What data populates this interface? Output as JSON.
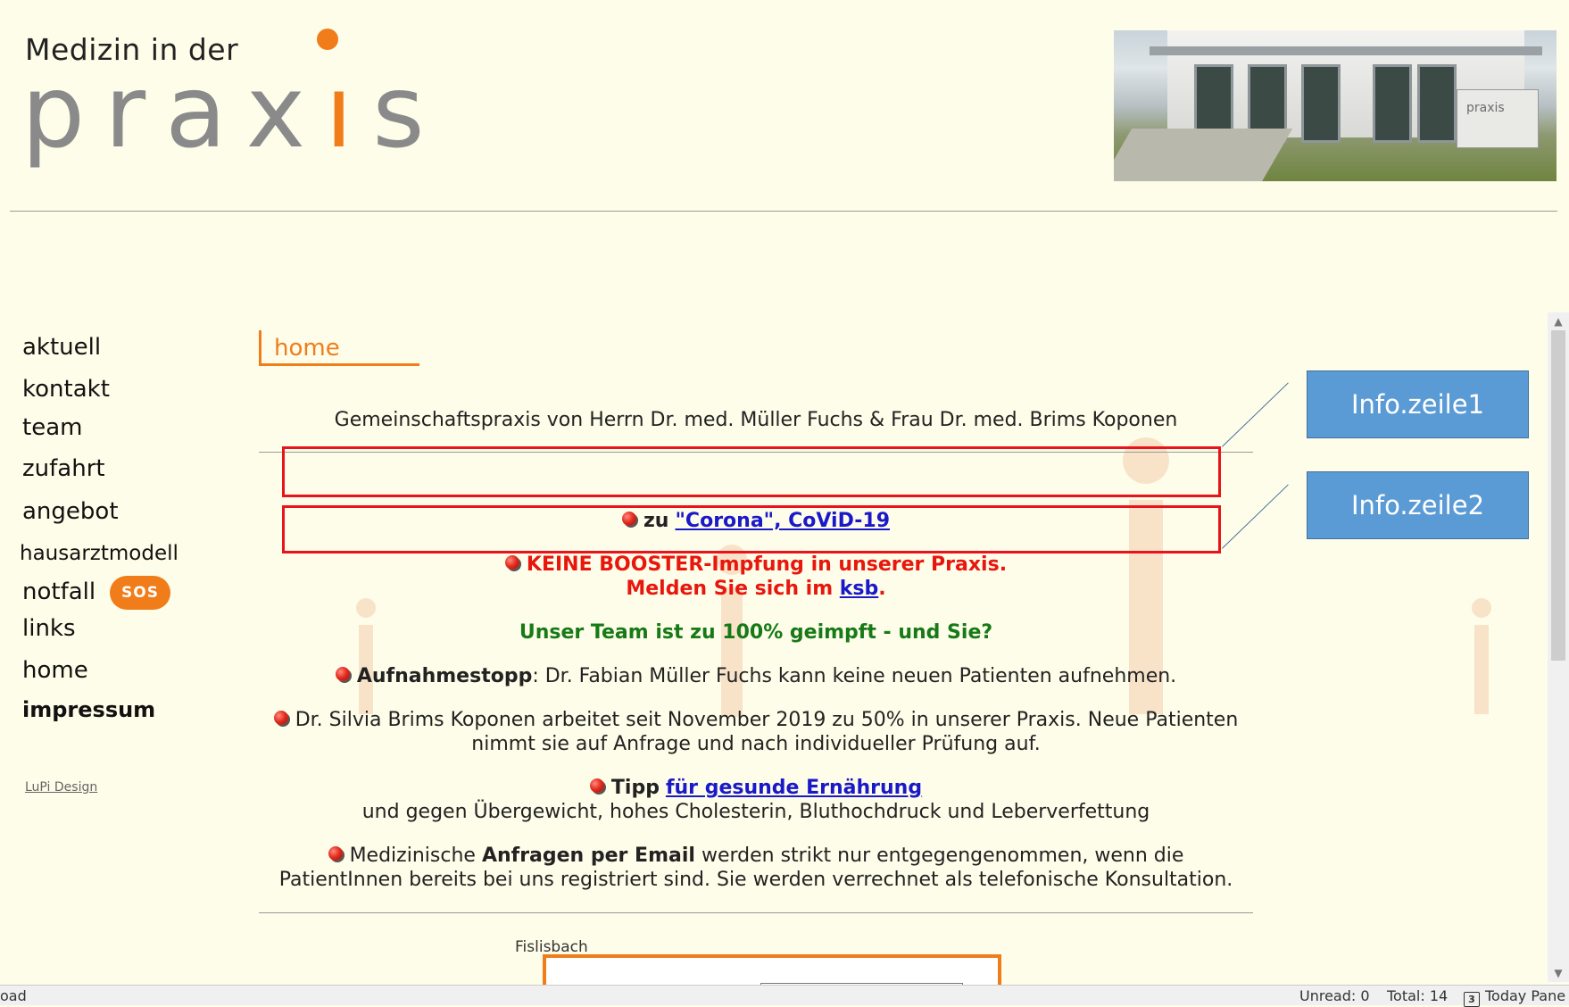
{
  "logo": {
    "small": "Medizin in der",
    "big_prefix": "prax",
    "big_i": "ı",
    "big_suffix": "s"
  },
  "building_sign": "praxis",
  "nav": [
    {
      "label": "aktuell"
    },
    {
      "label": "kontakt"
    },
    {
      "label": "team"
    },
    {
      "label": "zufahrt"
    },
    {
      "label": "angebot"
    },
    {
      "label": "hausarztmodell"
    },
    {
      "label": "notfall"
    },
    {
      "label": "links"
    },
    {
      "label": "home"
    },
    {
      "label": "impressum"
    }
  ],
  "sos_badge": "SOS",
  "credit": "LuPi Design",
  "page_title": "home",
  "content": {
    "intro": "Gemeinschaftspraxis von Herrn Dr. med. Müller Fuchs & Frau Dr. med. Brims Koponen",
    "corona_prefix": "zu",
    "corona_link": "\"Corona\", CoViD-19",
    "booster_line1": "KEINE BOOSTER-Impfung in unserer Praxis.",
    "booster_line2_prefix": "Melden Sie sich im",
    "booster_link": "ksb",
    "booster_line2_suffix": ".",
    "team": "Unser Team ist zu 100% geimpft - und Sie?",
    "stop_bold": "Aufnahmestopp",
    "stop_text": ": Dr. Fabian Müller Fuchs kann keine neuen Patienten aufnehmen.",
    "silvia_line1": "Dr. Silvia Brims Koponen arbeitet seit November 2019 zu 50% in unserer Praxis. Neue Patienten",
    "silvia_line2": "nimmt sie auf Anfrage und nach individueller Prüfung auf.",
    "tipp_bold": "Tipp",
    "tipp_link": "für gesunde Ernährung",
    "tipp_line2": "und gegen Übergewicht, hohes Cholesterin, Bluthochdruck und Leberverfettung",
    "email_pre": "Medizinische",
    "email_bold": "Anfragen per Email",
    "email_post": "werden strikt nur entgegengenommen, wenn die",
    "email_line2": "PatientInnen bereits bei uns registriert sind. Sie werden verrechnet als telefonische Konsultation.",
    "map_label": "Fislisbach"
  },
  "callouts": {
    "one": "Info.zeile1",
    "two": "Info.zeile2"
  },
  "status": {
    "left": "oad",
    "unread": "Unread: 0",
    "total": "Total: 14",
    "today_num": "3",
    "today": "Today Pane"
  },
  "colors": {
    "background": "#fefde9",
    "accent": "#f07d1a",
    "alert": "#e8170e",
    "ok": "#177a17",
    "link": "#1a19c9",
    "callout": "#5b9bd5"
  }
}
